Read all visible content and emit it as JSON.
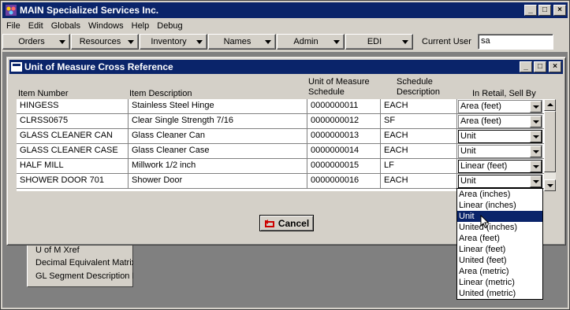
{
  "app": {
    "title": "MAIN Specialized Services Inc."
  },
  "menu": [
    "File",
    "Edit",
    "Globals",
    "Windows",
    "Help",
    "Debug"
  ],
  "toolbar": {
    "buttons": [
      "Orders",
      "Resources",
      "Inventory",
      "Names",
      "Admin",
      "EDI"
    ],
    "current_user_label": "Current User",
    "current_user_value": "sa"
  },
  "child_window": {
    "title": "Unit of Measure Cross Reference",
    "columns": {
      "item_number": "Item Number",
      "item_description": "Item Description",
      "uom_schedule_1": "Unit of Measure",
      "uom_schedule_2": "Schedule",
      "sched_desc_1": "Schedule",
      "sched_desc_2": "Description",
      "sell_by": "In Retail, Sell By"
    },
    "rows": [
      {
        "item": "HINGESS",
        "desc": "Stainless Steel Hinge",
        "schedule": "0000000011",
        "sched_desc": "EACH",
        "sell_by": "Area (feet)"
      },
      {
        "item": "CLRSS0675",
        "desc": "Clear Single Strength 7/16",
        "schedule": "0000000012",
        "sched_desc": "SF",
        "sell_by": "Area (feet)"
      },
      {
        "item": "GLASS CLEANER CAN",
        "desc": "Glass Cleaner Can",
        "schedule": "0000000013",
        "sched_desc": "EACH",
        "sell_by": "Unit"
      },
      {
        "item": "GLASS CLEANER CASE",
        "desc": "Glass Cleaner Case",
        "schedule": "0000000014",
        "sched_desc": "EACH",
        "sell_by": "Unit"
      },
      {
        "item": "HALF MILL",
        "desc": "Millwork 1/2 inch",
        "schedule": "0000000015",
        "sched_desc": "LF",
        "sell_by": "Linear (feet)"
      },
      {
        "item": "SHOWER DOOR 701",
        "desc": "Shower Door",
        "schedule": "0000000016",
        "sched_desc": "EACH",
        "sell_by": "Unit"
      }
    ],
    "cancel_label": "Cancel"
  },
  "dropdown_options": [
    "Area (inches)",
    "Linear (inches)",
    "Unit",
    "United (inches)",
    "Area (feet)",
    "Linear (feet)",
    "United (feet)",
    "Area (metric)",
    "Linear (metric)",
    "United (metric)"
  ],
  "dropdown_selected": "Unit",
  "background_menu": [
    "U of M Xref",
    "Decimal Equivalent Matrix",
    "GL Segment Description I"
  ],
  "colors": {
    "titlebar": "#0a246a",
    "face": "#d4d0c8",
    "desktop": "#808080"
  }
}
